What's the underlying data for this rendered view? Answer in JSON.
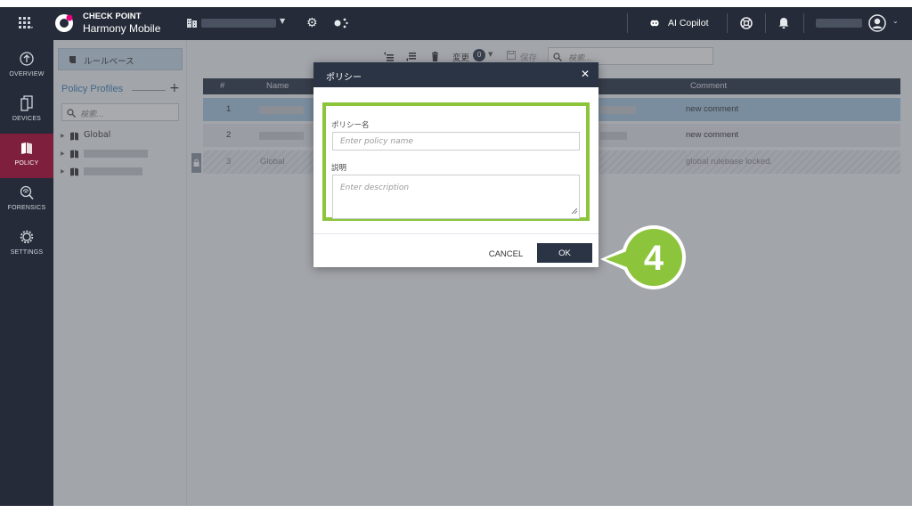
{
  "topbar": {
    "brand_line1": "CHECK POINT",
    "brand_line2": "Harmony Mobile",
    "copilot_label": "AI Copilot"
  },
  "nav": {
    "items": [
      {
        "label": "OVERVIEW",
        "icon": "arrow-up-circle-icon"
      },
      {
        "label": "DEVICES",
        "icon": "devices-icon"
      },
      {
        "label": "POLICY",
        "icon": "policy-icon",
        "active": true
      },
      {
        "label": "FORENSICS",
        "icon": "forensics-icon"
      },
      {
        "label": "SETTINGS",
        "icon": "gear-icon"
      }
    ]
  },
  "profiles": {
    "rulebase_button": "ルールベース",
    "title": "Policy Profiles",
    "search_placeholder": "検索...",
    "tree": [
      {
        "label": "Global"
      }
    ]
  },
  "toolbar": {
    "change_label": "変更",
    "change_count": "0",
    "save_label": "保存",
    "search_placeholder": "検索..."
  },
  "table": {
    "headers": {
      "num": "#",
      "name": "Name",
      "comment": "Comment"
    },
    "rows": [
      {
        "num": "1",
        "name": "",
        "comment": "new comment",
        "state": "selected"
      },
      {
        "num": "2",
        "name": "",
        "comment": "new comment",
        "state": "normal"
      },
      {
        "num": "3",
        "name": "Global",
        "comment": "global rulebase locked.",
        "state": "locked"
      }
    ]
  },
  "modal": {
    "title": "ポリシー",
    "name_label": "ポリシー名",
    "name_placeholder": "Enter policy name",
    "name_value": "",
    "desc_label": "説明",
    "desc_placeholder": "Enter description",
    "desc_value": "",
    "cancel_label": "CANCEL",
    "ok_label": "OK"
  },
  "annotation": {
    "step": "4",
    "color": "#8cc43c"
  },
  "colors": {
    "topbar": "#252b38",
    "nav_active": "#7d1f3d",
    "header": "#2b3445",
    "row_selected": "#a8c8e0",
    "link": "#3d7fb8",
    "highlight": "#8cc43c"
  }
}
